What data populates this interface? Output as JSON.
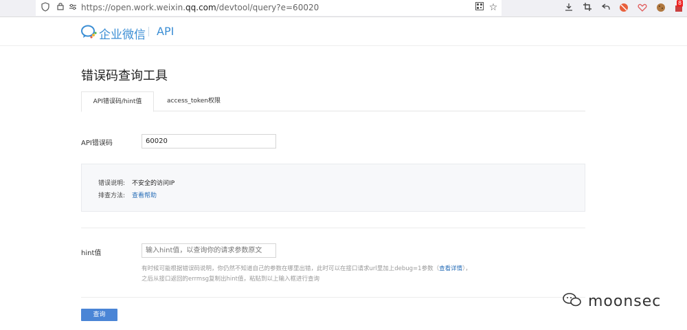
{
  "browser": {
    "url_prefix": "https://open.work.weixin.",
    "url_domain": "qq.com",
    "url_suffix": "/devtool/query?e=60020",
    "badge_count": "8"
  },
  "header": {
    "logo_text": "企业微信",
    "api_label": "API"
  },
  "page": {
    "title": "错误码查询工具",
    "tabs": [
      {
        "label": "API错误码/hint值",
        "active": true
      },
      {
        "label": "access_token权限",
        "active": false
      }
    ]
  },
  "query": {
    "errcode_label": "API错误码",
    "errcode_value": "60020"
  },
  "result": {
    "desc_label": "错误说明:",
    "desc_value": "不安全的访问IP",
    "method_label": "排查方法:",
    "method_link": "查看帮助"
  },
  "hint": {
    "label": "hint值",
    "placeholder": "输入hint值，以查询你的请求参数原文",
    "help_line1_prefix": "有时候可能根据错误码说明，你仍然不知道自己的参数在哪里出错，此时可以在接口请求url里加上debug=1参数（",
    "help_link": "查看详情",
    "help_line1_suffix": "），",
    "help_line2": "之后从接口返回的errmsg复制出hint值，粘贴到以上输入框进行查询"
  },
  "actions": {
    "query_button": "查询"
  },
  "watermark": {
    "text": "moonsec"
  }
}
